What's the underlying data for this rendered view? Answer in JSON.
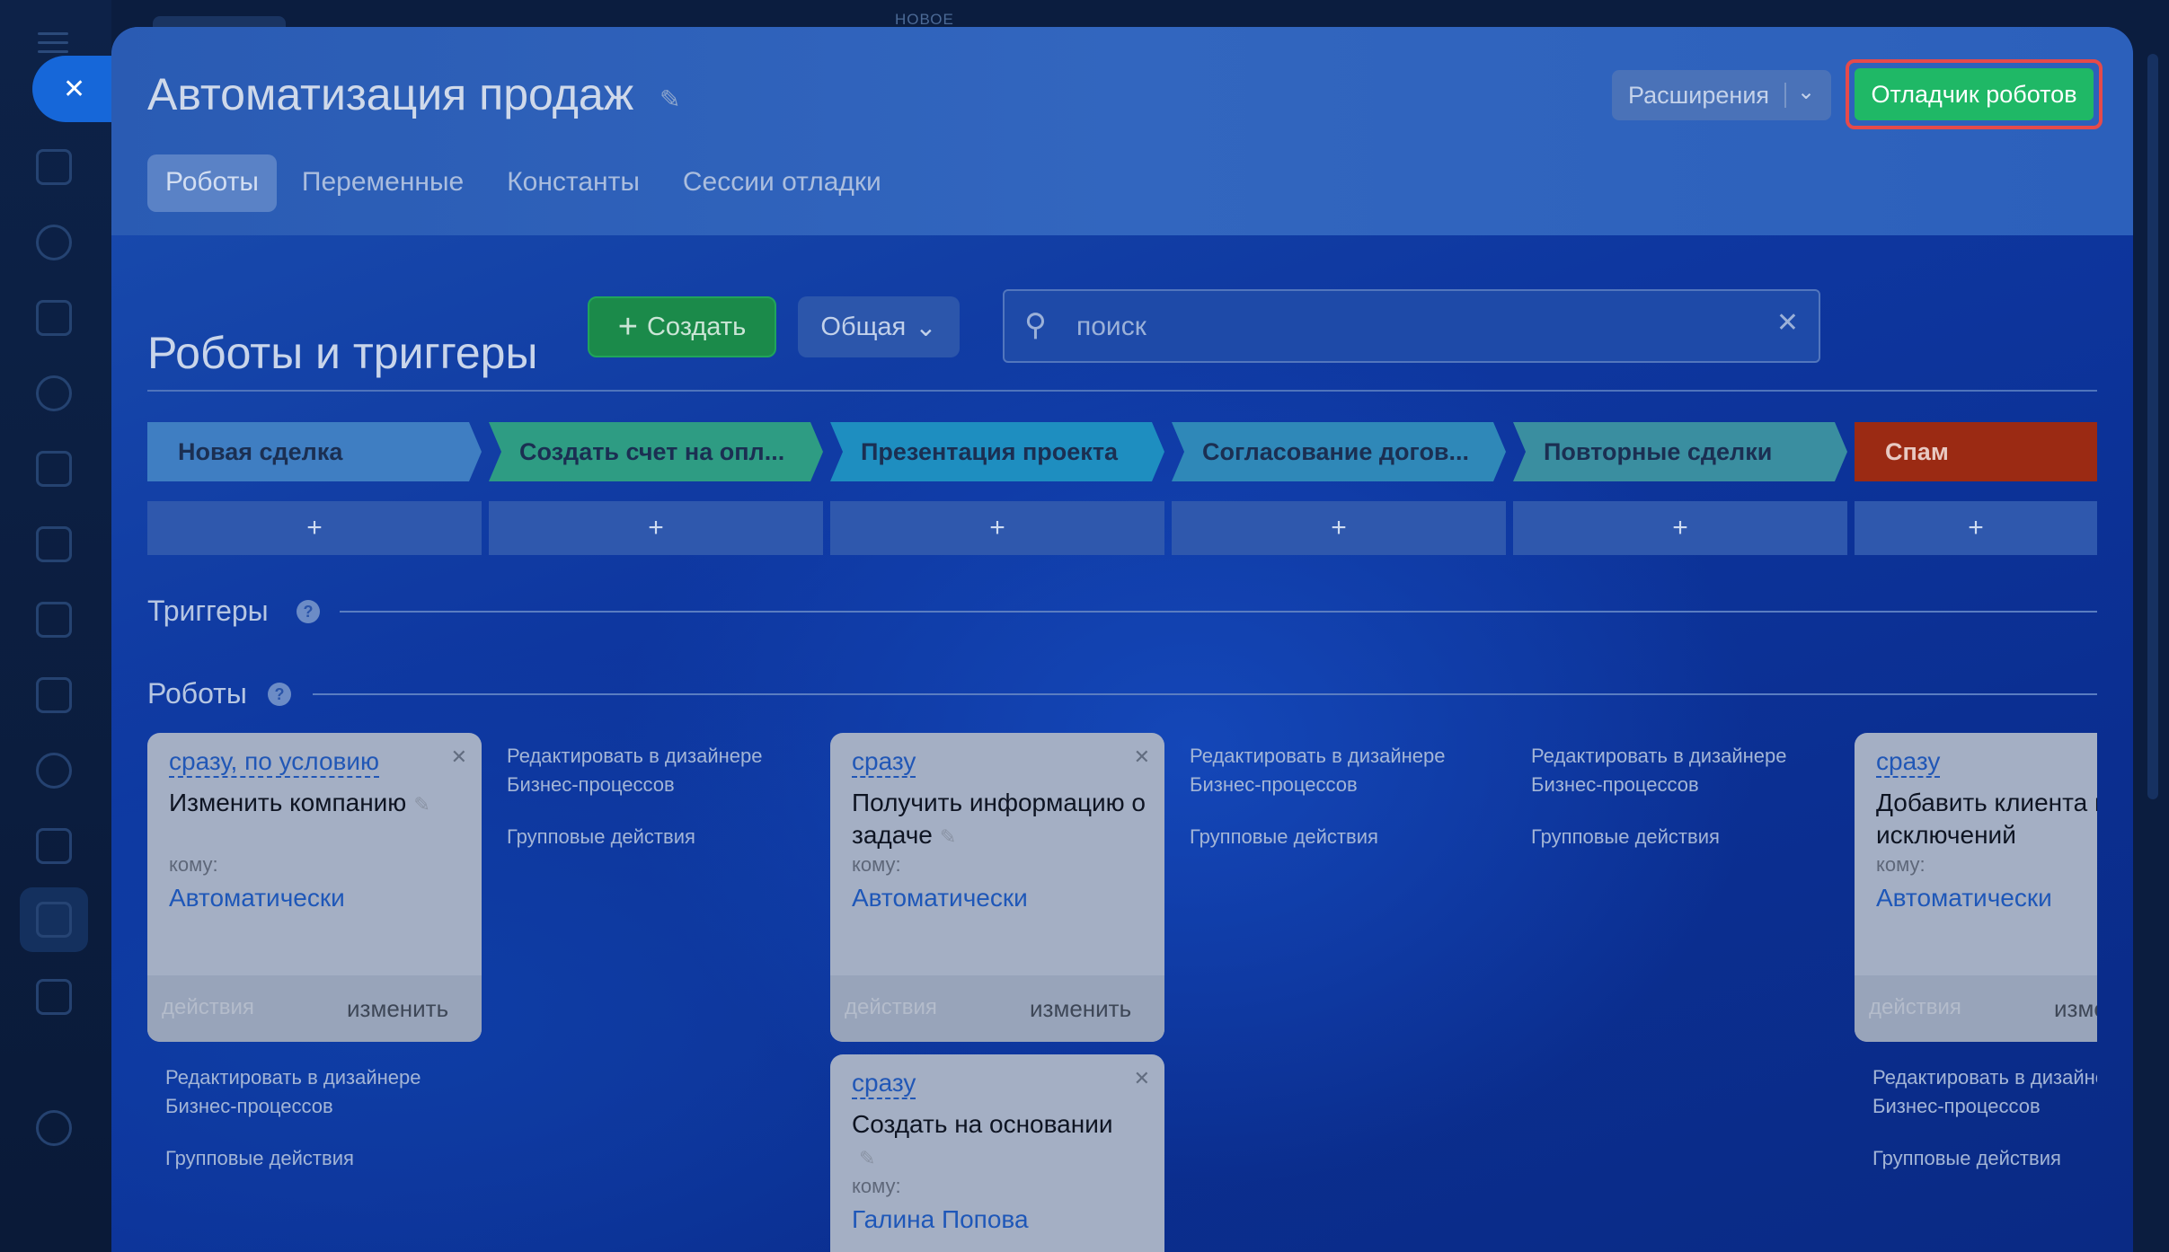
{
  "overlay_label": "НОВОЕ",
  "header": {
    "title": "Автоматизация продаж",
    "extensions_label": "Расширения",
    "debugger_label": "Отладчик роботов"
  },
  "tabs": [
    {
      "label": "Роботы",
      "active": true
    },
    {
      "label": "Переменные",
      "active": false
    },
    {
      "label": "Константы",
      "active": false
    },
    {
      "label": "Сессии отладки",
      "active": false
    }
  ],
  "toolbar": {
    "section_title": "Роботы и триггеры",
    "create_label": "Создать",
    "scope_label": "Общая",
    "search_placeholder": "поиск"
  },
  "stages": [
    {
      "label": "Новая сделка",
      "color": "#3f7ec2"
    },
    {
      "label": "Создать счет на опл...",
      "color": "#2e9c83"
    },
    {
      "label": "Презентация проекта",
      "color": "#1e8ec0"
    },
    {
      "label": "Согласование догов...",
      "color": "#2f88b8"
    },
    {
      "label": "Повторные сделки",
      "color": "#3a8ea0"
    },
    {
      "label": "Спам",
      "color": "#9b2a13"
    }
  ],
  "stage_add": "+",
  "triggers_title": "Триггеры",
  "robots_title": "Роботы",
  "help_glyph": "?",
  "labels": {
    "to": "кому:",
    "actions": "действия",
    "change": "изменить",
    "edit_designer_1": "Редактировать в дизайнере",
    "edit_designer_2": "Бизнес-процессов",
    "group_actions": "Групповые действия"
  },
  "cards": [
    {
      "when": "сразу, по условию",
      "name": "Изменить компанию",
      "assignee": "Автоматически"
    },
    {
      "when": "сразу",
      "name": "Получить информацию о задаче",
      "assignee": "Автоматически"
    },
    {
      "when": "сразу",
      "name": "Создать на основании",
      "assignee": "Галина Попова"
    },
    {
      "when": "сразу",
      "name": "Добавить клиента в список исключений",
      "assignee": "Автоматически"
    }
  ]
}
